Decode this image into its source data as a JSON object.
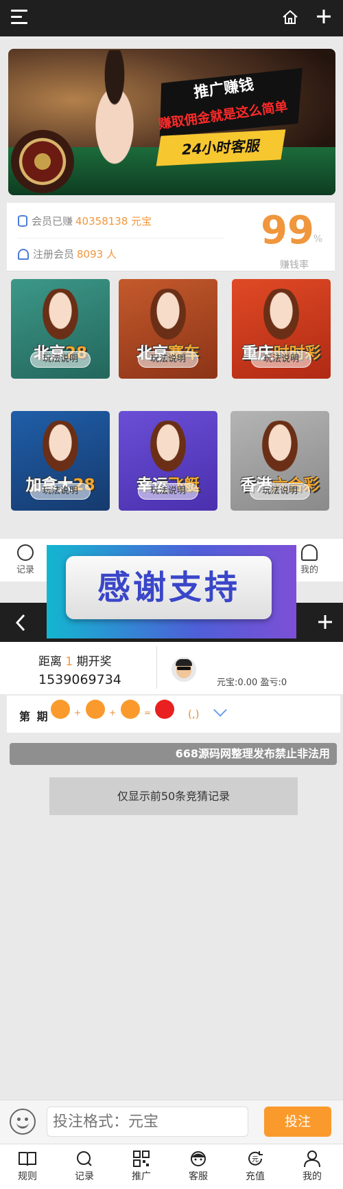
{
  "banner": {
    "line1": "推广赚钱",
    "line2": "赚取佣金就是这么简单",
    "line3": "24小时客服"
  },
  "stats": {
    "earned_label": "会员已赚",
    "earned_value": "40358138 元宝",
    "members_label": "注册会员",
    "members_value": "8093 人",
    "rate_value": "99",
    "rate_unit": "%",
    "rate_label": "赚钱率"
  },
  "games": [
    {
      "name_a": "北京",
      "name_b": "28",
      "howto": "玩法说明",
      "color": "#2f7f74"
    },
    {
      "name_a": "北京",
      "name_b": "赛车",
      "howto": "玩法说明",
      "color": "#a54322"
    },
    {
      "name_a": "重庆",
      "name_b": "时时彩",
      "howto": "玩法说明",
      "color": "#c2391c"
    },
    {
      "name_a": "加拿大",
      "name_b": "28",
      "howto": "玩法说明",
      "color": "#1f4d8c"
    },
    {
      "name_a": "幸运",
      "name_b": "飞艇",
      "howto": "玩法说明",
      "color": "#5a3fc2"
    },
    {
      "name_a": "香港",
      "name_b": "六合彩",
      "howto": "玩法说明",
      "color": "#9a9a9a"
    }
  ],
  "nav_strip": {
    "left": "记录",
    "right": "我的"
  },
  "overlay_text": "感谢支持",
  "draw": {
    "prefix": "距离",
    "period": "1",
    "suffix": "期开奖",
    "countdown": "1539069734",
    "balance": "元宝:0.00  盈亏:0"
  },
  "period_row": {
    "label": "第 期",
    "plus": "+",
    "equals": "=",
    "result": "(,)",
    "ball_color": "#fb9a2c",
    "result_ball_color": "#e8201f"
  },
  "marquee": "668源码网整理发布禁止非法用",
  "records_button": "仅显示前50条竞猜记录",
  "bet": {
    "placeholder": "投注格式：元宝",
    "submit": "投注"
  },
  "tabs": [
    "规则",
    "记录",
    "推广",
    "客服",
    "充值",
    "我的"
  ]
}
